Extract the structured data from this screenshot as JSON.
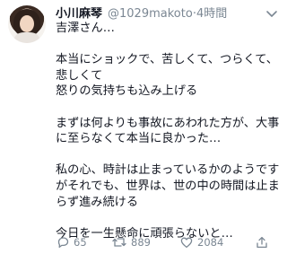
{
  "tweet": {
    "user": {
      "name": "小川麻琴",
      "handle": "@1029makoto",
      "separator": "·",
      "time": "4時間"
    },
    "text": "吉澤さん…\n\n本当にショックで、苦しくて、つらくて、悲しくて\n怒りの気持ちも込み上げる\n\nまずは何よりも事故にあわれた方が、大事に至らなくて本当に良かった…\n\n私の心、時計は止まっているかのようですがそれでも、世界は、世の中の時間は止まらず進み続ける\n\n今日を一生懸命に頑張らないと…",
    "actions": {
      "reply_count": "65",
      "retweet_count": "889",
      "like_count": "2084"
    },
    "icons": [
      "avatar",
      "chevron-down-icon",
      "reply-icon",
      "retweet-icon",
      "like-icon",
      "share-icon"
    ],
    "colors": {
      "text": "#141823",
      "muted": "#7b8793"
    }
  }
}
